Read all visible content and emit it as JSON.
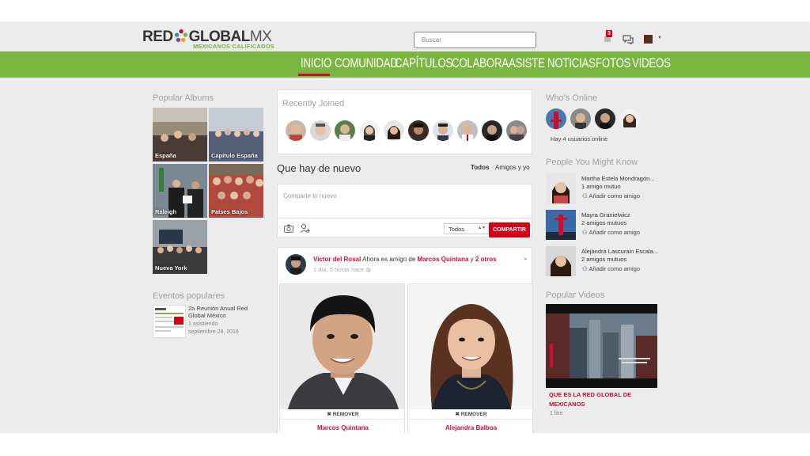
{
  "header": {
    "logo_red": "RED",
    "logo_global": "GLOBAL",
    "logo_mx": "MX",
    "logo_tagline": "MEXICANOS CALIFICADOS",
    "search_placeholder": "Buscar",
    "notification_count": "3"
  },
  "nav": {
    "items": [
      "INICIO",
      "COMUNIDAD",
      "CAPÍTULOS",
      "COLABORA",
      "ASISTE",
      "NOTICIAS",
      "FOTOS",
      "VIDEOS"
    ],
    "active": "INICIO",
    "accent_color": "#7bb541",
    "active_color": "#c8102e"
  },
  "left": {
    "albums_title": "Popular Albums",
    "albums": [
      {
        "label": "España"
      },
      {
        "label": "Capítulo España"
      },
      {
        "label": "Raleigh"
      },
      {
        "label": "Países Bajos"
      },
      {
        "label": "Nueva York"
      }
    ],
    "events_title": "Eventos populares",
    "event": {
      "name": "2a Reunión Anual Red Global México",
      "attending": "1 asistiendo",
      "date": "septiembre 28, 2016"
    }
  },
  "center": {
    "recent_title": "Recently Joined",
    "feed_title": "Que hay de nuevo",
    "filter_all": "Todos",
    "filter_friends": "Amigos y yo",
    "composer_placeholder": "Comparte lo nuevo",
    "privacy_value": "Todos",
    "share_label": "COMPARTIR",
    "post": {
      "author": "Victor del Rosal",
      "action": "Ahora es amigo de",
      "target": "Marcos Quintana",
      "conjunction": "y",
      "others": "2 otros",
      "time": "1 día, 5 horas hace"
    },
    "friends": [
      {
        "name": "Marcos Quintana",
        "remove_label": "REMOVER"
      },
      {
        "name": "Alejandra Balboa",
        "remove_label": "REMOVER"
      }
    ]
  },
  "right": {
    "online_title": "Who's Online",
    "online_count": "Hay 4 usuarios online",
    "pymk_title": "People You Might Know",
    "pymk": [
      {
        "name": "Martha Estela Mondragón...",
        "mutual": "1 amigo mutuo",
        "add": "Añadir como amigo"
      },
      {
        "name": "Mayra Granielwicz",
        "mutual": "2 amigos mutuos",
        "add": "Añadir como amigo"
      },
      {
        "name": "Alejandra Lascurain Escala...",
        "mutual": "2 amigos mutuos",
        "add": "Añadir como amigo"
      }
    ],
    "videos_title": "Popular Videos",
    "video": {
      "title": "QUE ES LA RED GLOBAL DE MEXICANOS",
      "likes": "1 like"
    }
  }
}
